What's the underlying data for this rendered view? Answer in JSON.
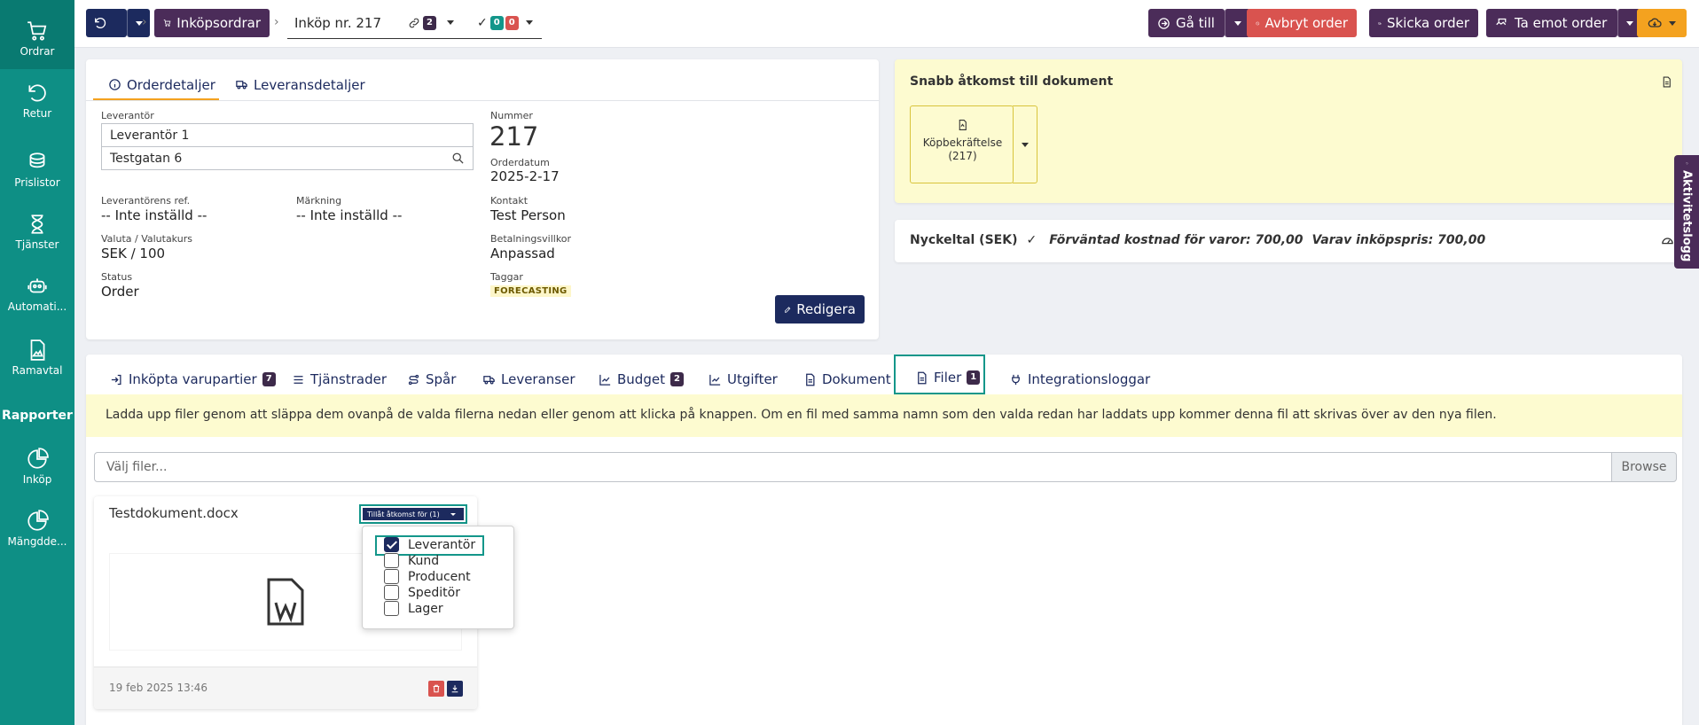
{
  "sidebar": {
    "items": [
      {
        "label": "Ordrar",
        "icon": "cart-icon"
      },
      {
        "label": "Retur",
        "icon": "return-icon"
      },
      {
        "label": "Prislistor",
        "icon": "coins-icon"
      },
      {
        "label": "Tjänster",
        "icon": "hourglass-icon"
      },
      {
        "label": "Automati...",
        "icon": "robot-icon"
      },
      {
        "label": "Ramavtal",
        "icon": "document-image-icon"
      }
    ],
    "section_heading": "Rapporter",
    "report_items": [
      {
        "label": "Inköp",
        "icon": "pie-chart-icon"
      },
      {
        "label": "Mängdde...",
        "icon": "pie-chart-icon"
      }
    ]
  },
  "topbar": {
    "breadcrumb_purchase_orders": "Inköpsordrar",
    "purchase_title": "Inköp nr. 217",
    "link_count": "2",
    "check_green": "0",
    "check_red": "0",
    "goto_label": "Gå till",
    "cancel_label": "Avbryt order",
    "send_label": "Skicka order",
    "receive_label": "Ta emot order"
  },
  "order_tabs": {
    "details": "Orderdetaljer",
    "delivery": "Leveransdetaljer"
  },
  "order": {
    "supplier_label": "Leverantör",
    "supplier_value": "Leverantör 1",
    "address_value": "Testgatan 6",
    "supplier_ref_label": "Leverantörens ref.",
    "supplier_ref_value": "-- Inte inställd --",
    "marking_label": "Märkning",
    "marking_value": "-- Inte inställd --",
    "currency_label": "Valuta / Valutakurs",
    "currency_value": "SEK / 100",
    "status_label": "Status",
    "status_value": "Order",
    "number_label": "Nummer",
    "number_value": "217",
    "date_label": "Orderdatum",
    "date_value": "2025-2-17",
    "contact_label": "Kontakt",
    "contact_value": "Test Person",
    "terms_label": "Betalningsvillkor",
    "terms_value": "Anpassad",
    "tags_label": "Taggar",
    "tag_value": "FORECASTING",
    "edit_label": "Redigera"
  },
  "quick_access": {
    "title": "Snabb åtkomst till dokument",
    "doc_label_line1": "Köpbekräftelse",
    "doc_label_line2": "(217)"
  },
  "kpi": {
    "title": "Nyckeltal (SEK)",
    "expected": "Förväntad kostnad för varor: 700,00",
    "purchase": "Varav inköpspris: 700,00"
  },
  "activity_log": "Aktivitetslogg",
  "main_tabs": [
    {
      "label": "Inköpta varupartier",
      "badge": "7"
    },
    {
      "label": "Tjänstrader",
      "badge": ""
    },
    {
      "label": "Spår",
      "badge": ""
    },
    {
      "label": "Leveranser",
      "badge": ""
    },
    {
      "label": "Budget",
      "badge": "2"
    },
    {
      "label": "Utgifter",
      "badge": ""
    },
    {
      "label": "Dokument",
      "badge": ""
    },
    {
      "label": "Filer",
      "badge": "1"
    },
    {
      "label": "Integrationsloggar",
      "badge": ""
    }
  ],
  "files": {
    "info": "Ladda upp filer genom att släppa dem ovanpå de valda filerna nedan eller genom att klicka på knappen. Om en fil med samma namn som den valda redan har laddats upp kommer denna fil att skrivas över av den nya filen.",
    "picker_placeholder": "Välj filer...",
    "browse_label": "Browse",
    "file_name": "Testdokument.docx",
    "access_button": "Tillåt åtkomst för (1)",
    "file_date": "19 feb 2025 13:46",
    "access_options": [
      {
        "label": "Leverantör",
        "checked": true
      },
      {
        "label": "Kund",
        "checked": false
      },
      {
        "label": "Producent",
        "checked": false
      },
      {
        "label": "Speditör",
        "checked": false
      },
      {
        "label": "Lager",
        "checked": false
      }
    ]
  },
  "colors": {
    "sidebar": "#0e8f85",
    "purple": "#4b2c59",
    "red": "#d9534f",
    "navy": "#1c2a5e",
    "orange": "#f4a21f",
    "yellow_bg": "#fdfbd0"
  }
}
